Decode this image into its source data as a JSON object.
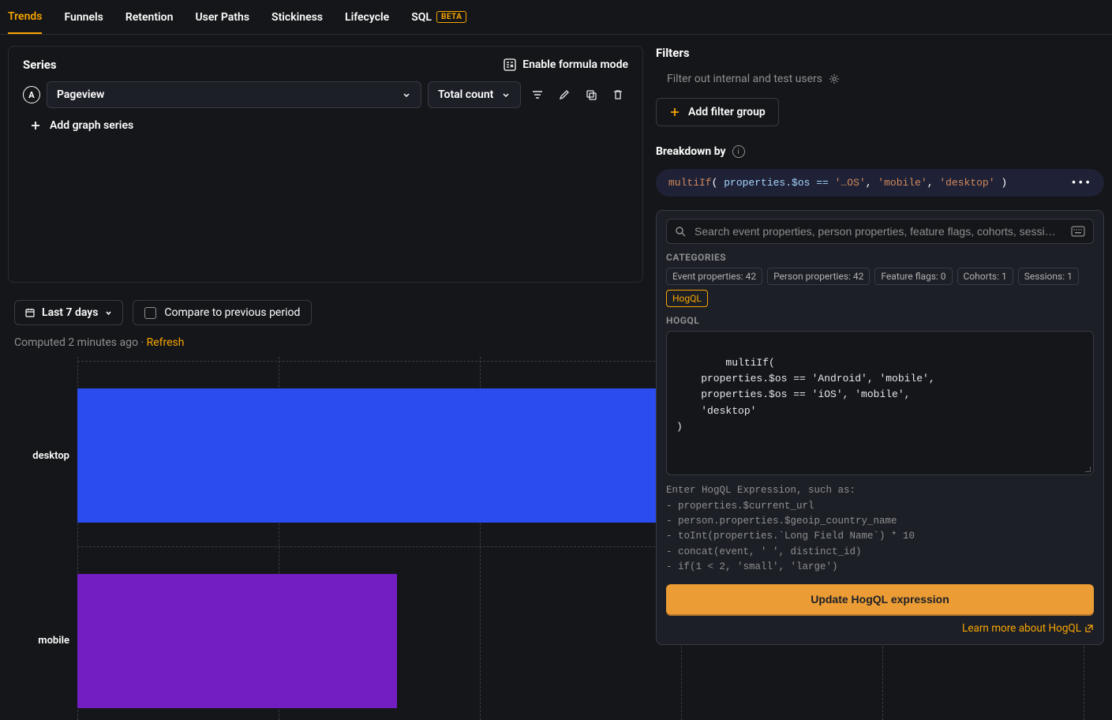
{
  "tabs": {
    "trends": "Trends",
    "funnels": "Funnels",
    "retention": "Retention",
    "user_paths": "User Paths",
    "stickiness": "Stickiness",
    "lifecycle": "Lifecycle",
    "sql": "SQL",
    "sql_badge": "BETA"
  },
  "series": {
    "title": "Series",
    "formula_toggle": "Enable formula mode",
    "badge": "A",
    "event": "Pageview",
    "count": "Total count",
    "add": "Add graph series"
  },
  "filters": {
    "title": "Filters",
    "internal": "Filter out internal and test users",
    "add": "Add filter group"
  },
  "breakdown": {
    "title": "Breakdown by",
    "pill": {
      "fn": "multiIf",
      "arg_prop": "properties.$os",
      "arg_val1": "'…OS'",
      "arg_val2": "'mobile'",
      "arg_val3": "'desktop'",
      "op": "=="
    }
  },
  "popover": {
    "search_placeholder": "Search event properties, person properties, feature flags, cohorts, sessi…",
    "categories_label": "CATEGORIES",
    "categories": {
      "event": "Event properties: 42",
      "person": "Person properties: 42",
      "flags": "Feature flags: 0",
      "cohorts": "Cohorts: 1",
      "sessions": "Sessions: 1",
      "hogql": "HogQL"
    },
    "hogql_label": "HOGQL",
    "code": "multiIf(\n    properties.$os == 'Android', 'mobile',\n    properties.$os == 'iOS', 'mobile',\n    'desktop'\n)",
    "hint": "Enter HogQL Expression, such as:\n- properties.$current_url\n- person.properties.$geoip_country_name\n- toInt(properties.`Long Field Name`) * 10\n- concat(event, ' ', distinct_id)\n- if(1 < 2, 'small', 'large')",
    "update": "Update HogQL expression",
    "learn": "Learn more about HogQL"
  },
  "controls": {
    "date": "Last 7 days",
    "compare": "Compare to previous period"
  },
  "computed": {
    "text": "Computed 2 minutes ago",
    "refresh": "Refresh"
  },
  "chart_data": {
    "type": "bar",
    "orientation": "horizontal",
    "categories": [
      "desktop",
      "mobile"
    ],
    "series": [
      {
        "name": "desktop",
        "value": 1300,
        "color": "#2b4cee"
      },
      {
        "name": "mobile",
        "value": 405,
        "color": "#721ec3"
      }
    ]
  }
}
